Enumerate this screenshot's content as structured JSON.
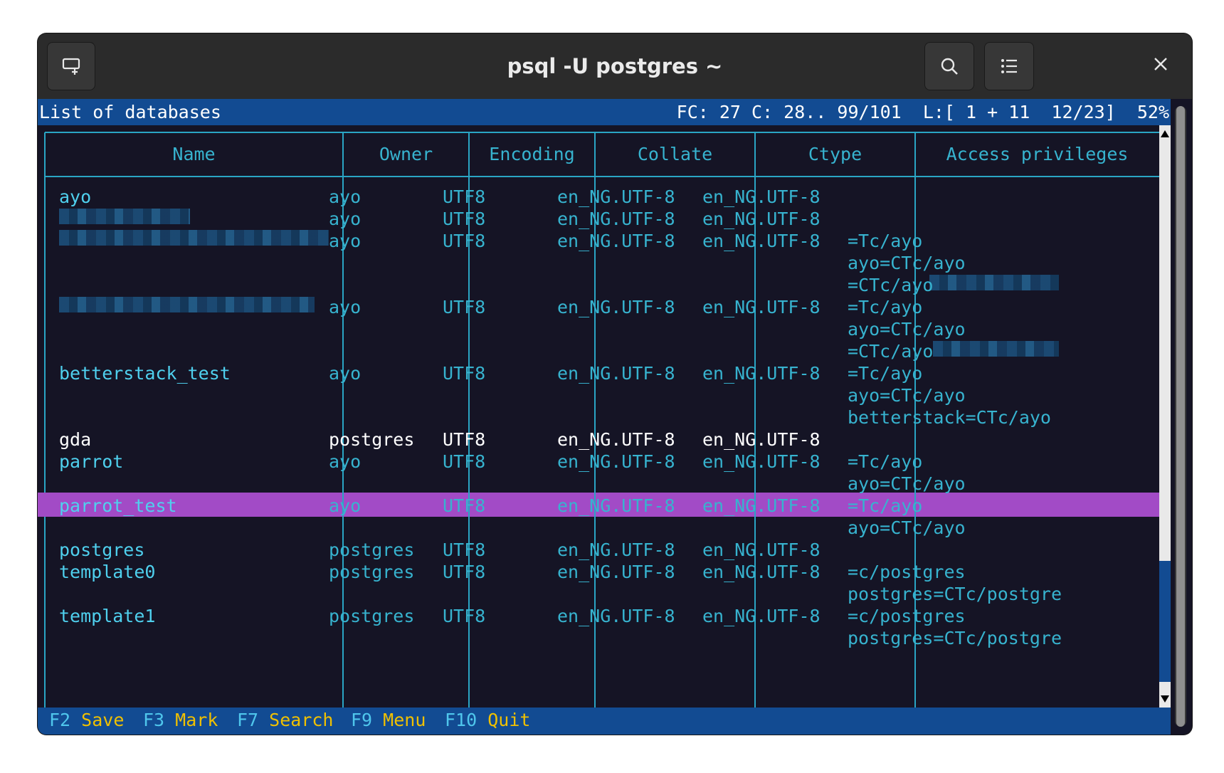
{
  "window": {
    "title": "psql -U postgres ~",
    "icons": {
      "new_tab": "new-tab-icon",
      "search": "search-icon",
      "menu": "list-menu-icon",
      "close": "close-icon"
    }
  },
  "status_bar": {
    "left": "List of databases",
    "right": "FC: 27 C: 28.. 99/101  L:[ 1 + 11  12/23]  52%"
  },
  "table": {
    "headers": [
      "Name",
      "Owner",
      "Encoding",
      "Collate",
      "Ctype",
      "Access privileges"
    ],
    "rows": [
      {
        "name": "ayo",
        "owner": "ayo",
        "encoding": "UTF8",
        "collate": "en_NG.UTF-8",
        "ctype": "en_NG.UTF-8",
        "privileges": []
      },
      {
        "name": "",
        "owner": "ayo",
        "encoding": "UTF8",
        "collate": "en_NG.UTF-8",
        "ctype": "en_NG.UTF-8",
        "privileges": []
      },
      {
        "name": "",
        "owner": "ayo",
        "encoding": "UTF8",
        "collate": "en_NG.UTF-8",
        "ctype": "en_NG.UTF-8",
        "privileges": [
          "=Tc/ayo",
          "ayo=CTc/ayo",
          "=CTc/ayo"
        ]
      },
      {
        "name": "",
        "owner": "ayo",
        "encoding": "UTF8",
        "collate": "en_NG.UTF-8",
        "ctype": "en_NG.UTF-8",
        "privileges": [
          "=Tc/ayo",
          "ayo=CTc/ayo",
          "=CTc/ayo"
        ]
      },
      {
        "name": "betterstack_test",
        "owner": "ayo",
        "encoding": "UTF8",
        "collate": "en_NG.UTF-8",
        "ctype": "en_NG.UTF-8",
        "privileges": [
          "=Tc/ayo",
          "ayo=CTc/ayo",
          "betterstack=CTc/ayo"
        ]
      },
      {
        "name": "gda",
        "owner": "postgres",
        "encoding": "UTF8",
        "collate": "en_NG.UTF-8",
        "ctype": "en_NG.UTF-8",
        "privileges": []
      },
      {
        "name": "parrot",
        "owner": "ayo",
        "encoding": "UTF8",
        "collate": "en_NG.UTF-8",
        "ctype": "en_NG.UTF-8",
        "privileges": [
          "=Tc/ayo",
          "ayo=CTc/ayo"
        ]
      },
      {
        "name": "parrot_test",
        "owner": "ayo",
        "encoding": "UTF8",
        "collate": "en_NG.UTF-8",
        "ctype": "en_NG.UTF-8",
        "privileges": [
          "=Tc/ayo",
          "ayo=CTc/ayo"
        ]
      },
      {
        "name": "postgres",
        "owner": "postgres",
        "encoding": "UTF8",
        "collate": "en_NG.UTF-8",
        "ctype": "en_NG.UTF-8",
        "privileges": []
      },
      {
        "name": "template0",
        "owner": "postgres",
        "encoding": "UTF8",
        "collate": "en_NG.UTF-8",
        "ctype": "en_NG.UTF-8",
        "privileges": [
          "=c/postgres",
          "postgres=CTc/postgre"
        ]
      },
      {
        "name": "template1",
        "owner": "postgres",
        "encoding": "UTF8",
        "collate": "en_NG.UTF-8",
        "ctype": "en_NG.UTF-8",
        "privileges": [
          "=c/postgres",
          "postgres=CTc/postgre"
        ]
      }
    ],
    "selected_row": "gda"
  },
  "function_keys": [
    {
      "key": "F2",
      "label": "Save"
    },
    {
      "key": "F3",
      "label": "Mark"
    },
    {
      "key": "F7",
      "label": "Search"
    },
    {
      "key": "F9",
      "label": "Menu"
    },
    {
      "key": "F10",
      "label": "Quit"
    }
  ],
  "colors": {
    "status_bar": "#124b92",
    "terminal_bg": "#151425",
    "text_cyan": "#37b3cf",
    "highlight": "#a24bc6",
    "fkey_label": "#f0c000"
  }
}
